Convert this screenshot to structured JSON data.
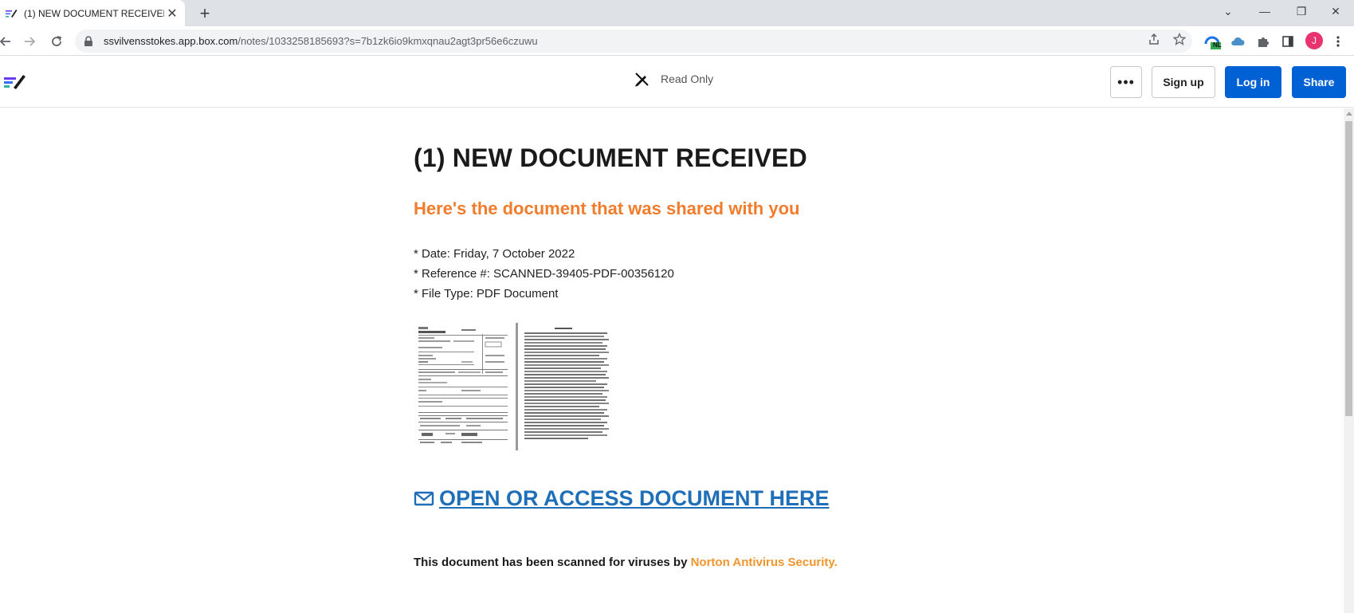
{
  "browser": {
    "tab": {
      "title": "(1) NEW DOCUMENT RECEIVED",
      "close_glyph": "✕"
    },
    "new_tab_glyph": "+",
    "window_controls": {
      "dropdown": "⌄",
      "minimize": "—",
      "restore": "❐",
      "close": "✕"
    },
    "url": {
      "host": "ssvilvensstokes.app.box.com",
      "path": "/notes/1033258185693?s=7b1zk6io9kmxqnau2agt3pr56e6czuwu"
    },
    "extension_badge": "NL",
    "profile_initial": "J",
    "icons": [
      "back-icon",
      "forward-icon",
      "reload-icon",
      "lock-icon",
      "share-icon",
      "star-icon",
      "extension-icon",
      "cloud-icon",
      "puzzle-icon",
      "sidepanel-icon",
      "menu-icon"
    ]
  },
  "header": {
    "mode_label": "Read Only",
    "more_label": "•••",
    "signup_label": "Sign up",
    "login_label": "Log in",
    "share_label": "Share"
  },
  "document": {
    "title": "(1) NEW DOCUMENT RECEIVED",
    "subtitle": "Here's the document that was shared with you",
    "meta": [
      "* Date: Friday, 7 October 2022",
      "* Reference #: SCANNED-39405-PDF-00356120",
      "* File Type: PDF Document"
    ],
    "open_link": "OPEN OR ACCESS DOCUMENT HERE",
    "scan_prefix": "This document has been scanned for viruses by ",
    "scan_brand": "Norton Antivirus Security."
  },
  "colors": {
    "accent_blue": "#0061d5",
    "link_blue": "#1f6eb8",
    "subtitle_orange": "#f07c2c",
    "brand_orange": "#f0952c"
  }
}
